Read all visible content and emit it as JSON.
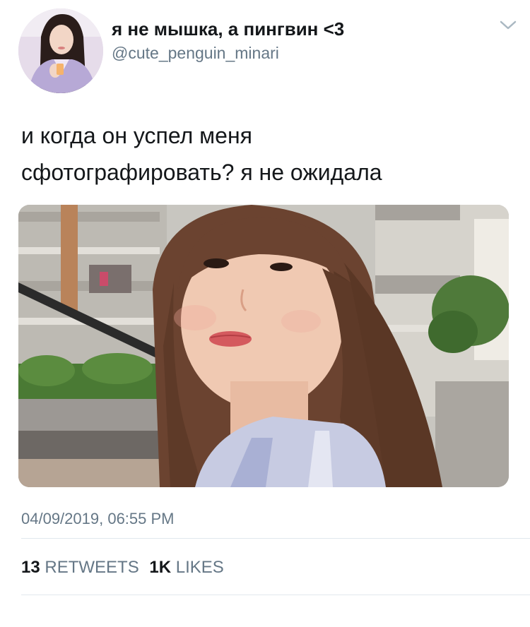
{
  "tweet": {
    "display_name": "я не мышка, а пингвин <3",
    "handle": "@cute_penguin_minari",
    "text_line1": "и когда он успел меня",
    "text_line2": "сфотографировать? я не ожидала",
    "timestamp": "04/09/2019, 06:55 PM",
    "retweets_count": "13",
    "retweets_label": "RETWEETS",
    "likes_count": "1K",
    "likes_label": "LIKES"
  },
  "icons": {
    "menu": "chevron-down-icon"
  },
  "colors": {
    "text_primary": "#14171a",
    "text_secondary": "#657786",
    "divider": "#e1e8ed"
  }
}
